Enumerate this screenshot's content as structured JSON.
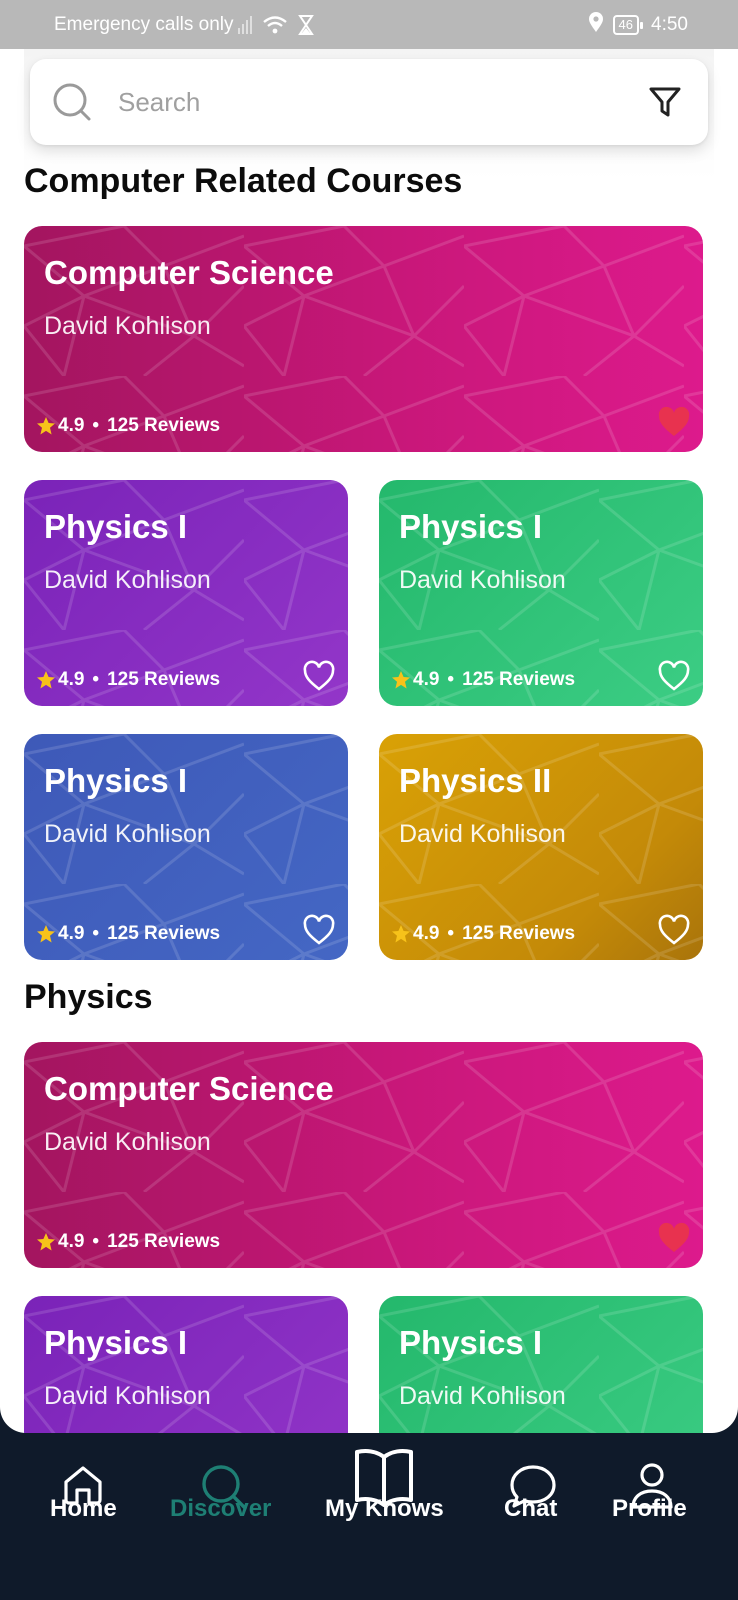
{
  "status_bar": {
    "carrier": "Emergency calls only",
    "battery": "46",
    "time": "4:50"
  },
  "search": {
    "placeholder": "Search"
  },
  "sections": [
    {
      "title": "Computer Related Courses",
      "cards": [
        {
          "title": "Computer Science",
          "author": "David Kohlison",
          "rating": "4.9",
          "reviews": "125 Reviews",
          "color": "#c81779",
          "favorite": true
        },
        {
          "title": "Physics I",
          "author": "David Kohlison",
          "rating": "4.9",
          "reviews": "125 Reviews",
          "color": "#8a2fc2",
          "favorite": false
        },
        {
          "title": "Physics I",
          "author": "David Kohlison",
          "rating": "4.9",
          "reviews": "125 Reviews",
          "color": "#32c47a",
          "favorite": false
        },
        {
          "title": "Physics I",
          "author": "David Kohlison",
          "rating": "4.9",
          "reviews": "125 Reviews",
          "color": "#4160be",
          "favorite": false
        },
        {
          "title": "Physics II",
          "author": "David Kohlison",
          "rating": "4.9",
          "reviews": "125 Reviews",
          "color": "#cf9507",
          "favorite": false
        }
      ]
    },
    {
      "title": "Physics",
      "cards": [
        {
          "title": "Computer Science",
          "author": "David Kohlison",
          "rating": "4.9",
          "reviews": "125 Reviews",
          "color": "#c81779",
          "favorite": true
        },
        {
          "title": "Physics I",
          "author": "David Kohlison",
          "color": "#8a2fc2"
        },
        {
          "title": "Physics I",
          "author": "David Kohlison",
          "color": "#32c47a"
        }
      ]
    }
  ],
  "nav": {
    "items": [
      {
        "label": "Home",
        "icon": "home-icon",
        "active": false
      },
      {
        "label": "Discover",
        "icon": "search-icon",
        "active": true
      },
      {
        "label": "My Knows",
        "icon": "book-icon",
        "active": false
      },
      {
        "label": "Chat",
        "icon": "chat-bubble-icon",
        "active": false
      },
      {
        "label": "Profile",
        "icon": "person-icon",
        "active": false
      }
    ],
    "active_color": "#1e7f74"
  },
  "colors": {
    "star": "#f7c21a",
    "heart_filled": "#e8324f",
    "nav_background": "#0f1a2a"
  }
}
